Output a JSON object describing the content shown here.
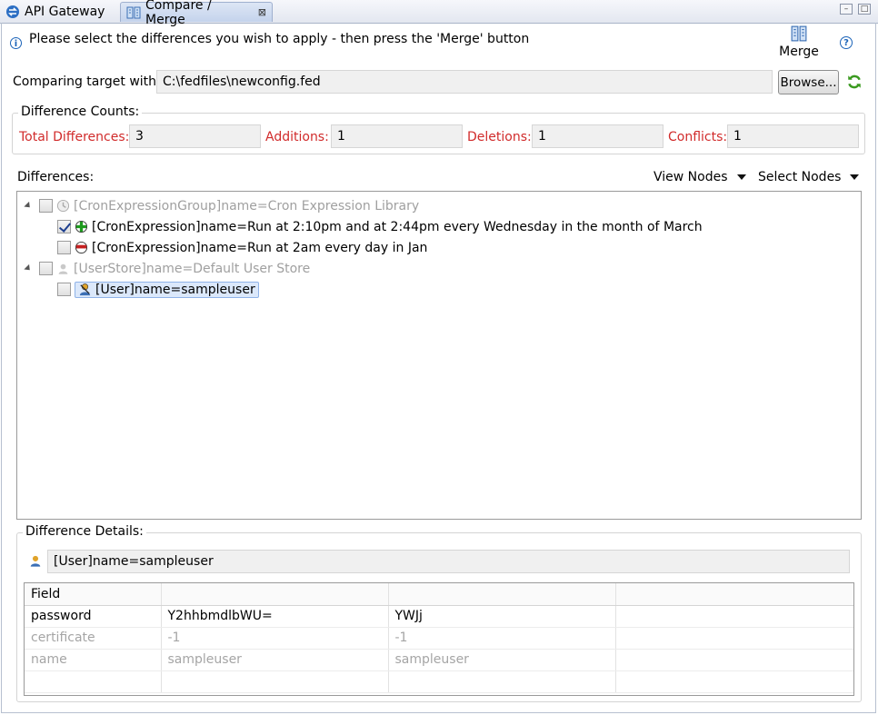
{
  "tabs": [
    {
      "label": "API Gateway",
      "icon": "api-gateway-icon"
    },
    {
      "label": "Compare / Merge",
      "icon": "compare-merge-icon",
      "active": true
    }
  ],
  "header": {
    "instruction": "Please select the differences you wish to apply - then press the 'Merge' button",
    "merge_label": "Merge",
    "help_icon": "help-icon"
  },
  "target": {
    "label": "Comparing target with:",
    "value": "C:\\fedfiles\\newconfig.fed",
    "browse_label": "Browse...",
    "refresh_icon": "refresh-icon"
  },
  "counts": {
    "title": "Difference Counts:",
    "total_label": "Total Differences:",
    "total_value": "3",
    "additions_label": "Additions:",
    "additions_value": "1",
    "deletions_label": "Deletions:",
    "deletions_value": "1",
    "conflicts_label": "Conflicts:",
    "conflicts_value": "1"
  },
  "differences": {
    "label": "Differences:",
    "view_nodes": "View Nodes",
    "select_nodes": "Select Nodes",
    "tree": [
      {
        "text": "[CronExpressionGroup]name=Cron Expression Library",
        "level": 0,
        "checked": false,
        "dim": true,
        "icon": "cron-group-icon"
      },
      {
        "text": "[CronExpression]name=Run at 2:10pm and at 2:44pm every Wednesday in the month of March",
        "level": 1,
        "checked": true,
        "dim": false,
        "icon": "addition-icon"
      },
      {
        "text": "[CronExpression]name=Run at 2am every day in Jan",
        "level": 1,
        "checked": false,
        "dim": false,
        "icon": "deletion-icon"
      },
      {
        "text": "[UserStore]name=Default User Store",
        "level": 0,
        "checked": false,
        "dim": true,
        "icon": "user-store-icon"
      },
      {
        "text": "[User]name=sampleuser",
        "level": 1,
        "checked": false,
        "dim": false,
        "icon": "conflict-user-icon",
        "selected": true
      }
    ]
  },
  "details": {
    "title": "Difference Details:",
    "selected": "[User]name=sampleuser",
    "columns": [
      "Field",
      "",
      "",
      ""
    ],
    "rows": [
      {
        "cells": [
          "password",
          "Y2hhbmdlbWU=",
          "YWJj",
          ""
        ],
        "dim": false
      },
      {
        "cells": [
          "certificate",
          "-1",
          "-1",
          ""
        ],
        "dim": true
      },
      {
        "cells": [
          "name",
          "sampleuser",
          "sampleuser",
          ""
        ],
        "dim": true
      },
      {
        "cells": [
          "",
          "",
          "",
          ""
        ],
        "dim": false
      }
    ]
  },
  "colors": {
    "label_red": "#d12b2b",
    "tab_active": "#c4d3ec",
    "selection": "#dbe8fb"
  }
}
